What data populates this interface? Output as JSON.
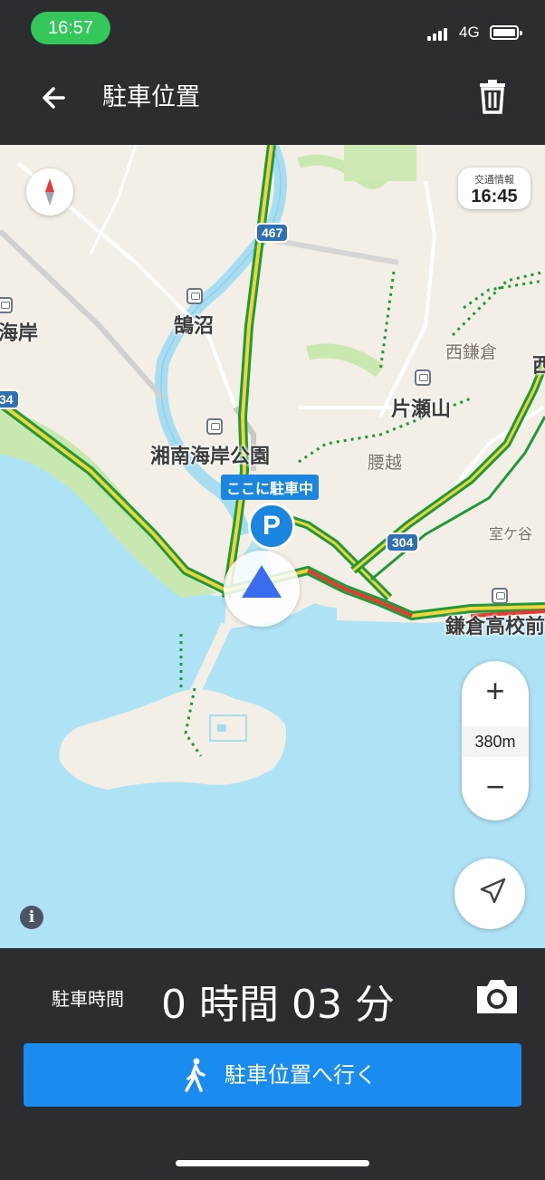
{
  "status_bar": {
    "time": "16:57",
    "network": "4G"
  },
  "header": {
    "title": "駐車位置"
  },
  "map": {
    "traffic_info": {
      "label": "交通情報",
      "time": "16:45"
    },
    "zoom": {
      "plus": "+",
      "minus": "−",
      "scale": "380m"
    },
    "parked_label": "ここに駐車中",
    "parking_pin": "P",
    "info_icon": "i",
    "labels": {
      "kugenuma": "鵠沼",
      "kaigan_left": "海岸",
      "shonan_park": "湘南海岸公園",
      "katasezan": "片瀬山",
      "koshigoe": "腰越",
      "nishikamakura": "西鎌倉",
      "nishi_edge": "西",
      "murogaya": "室ケ谷",
      "kamakura_hs": "鎌倉高校前"
    },
    "route_shields": {
      "r467": "467",
      "r304": "304",
      "r34": "34"
    }
  },
  "bottom": {
    "duration_label": "駐車時間",
    "duration_value": "0 時間 03 分",
    "go_button": "駐車位置へ行く"
  },
  "colors": {
    "accent": "#1a8cf0",
    "bar": "#2b2d30",
    "status_pill": "#34c759",
    "water": "#aee3f5",
    "park": "#c9e8b0",
    "road_green": "#1f9a3a",
    "road_yellow": "#f1d33b",
    "road_red": "#e53935"
  },
  "icons": [
    "back-arrow-icon",
    "trash-icon",
    "compass-icon",
    "locate-icon",
    "info-icon",
    "camera-icon",
    "walk-icon"
  ]
}
